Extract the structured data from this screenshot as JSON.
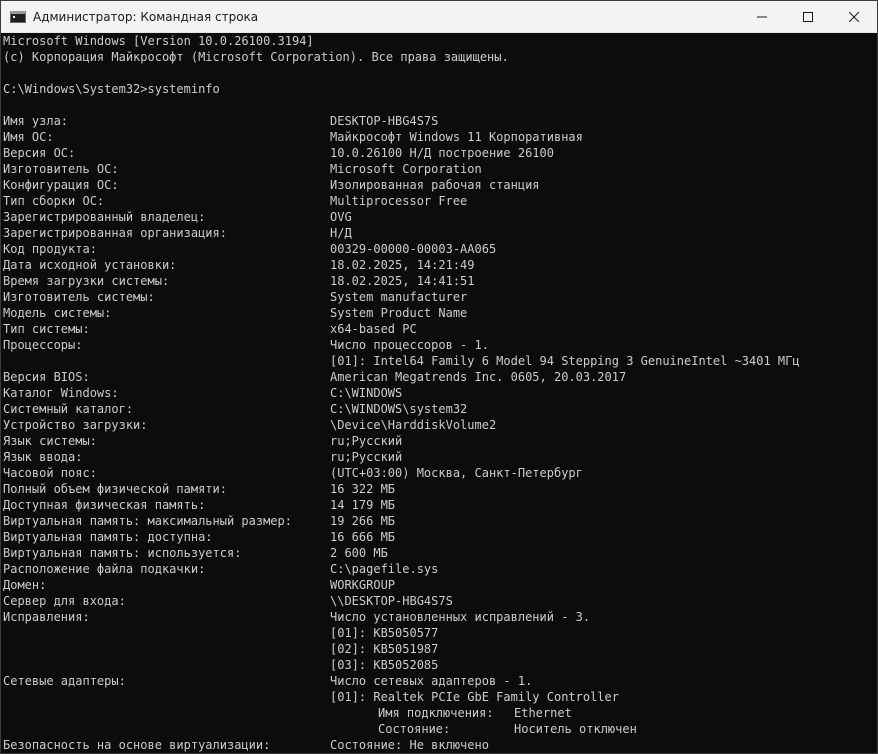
{
  "window": {
    "title": "Администратор: Командная строка",
    "icon": "cmd-icon",
    "controls": {
      "minimize_icon": "minimize-icon",
      "maximize_icon": "maximize-icon",
      "close_icon": "close-icon"
    }
  },
  "console": {
    "header": [
      "Microsoft Windows [Version 10.0.26100.3194]",
      "(c) Корпорация Майкрософт (Microsoft Corporation). Все права защищены."
    ],
    "prompt": "C:\\Windows\\System32>systeminfo",
    "fields": [
      {
        "key": "Имя узла:",
        "value": "DESKTOP-HBG4S7S"
      },
      {
        "key": "Имя ОС:",
        "value": "Майкрософт Windows 11 Корпоративная"
      },
      {
        "key": "Версия ОС:",
        "value": "10.0.26100 Н/Д построение 26100"
      },
      {
        "key": "Изготовитель ОС:",
        "value": "Microsoft Corporation"
      },
      {
        "key": "Конфигурация ОС:",
        "value": "Изолированная рабочая станция"
      },
      {
        "key": "Тип сборки ОС:",
        "value": "Multiprocessor Free"
      },
      {
        "key": "Зарегистрированный владелец:",
        "value": "OVG"
      },
      {
        "key": "Зарегистрированная организация:",
        "value": "Н/Д"
      },
      {
        "key": "Код продукта:",
        "value": "00329-00000-00003-AA065"
      },
      {
        "key": "Дата исходной установки:",
        "value": "18.02.2025, 14:21:49"
      },
      {
        "key": "Время загрузки системы:",
        "value": "18.02.2025, 14:41:51"
      },
      {
        "key": "Изготовитель системы:",
        "value": "System manufacturer"
      },
      {
        "key": "Модель системы:",
        "value": "System Product Name"
      },
      {
        "key": "Тип системы:",
        "value": "x64-based PC"
      },
      {
        "key": "Процессоры:",
        "value": "Число процессоров - 1."
      },
      {
        "key": "",
        "value": "[01]: Intel64 Family 6 Model 94 Stepping 3 GenuineIntel ~3401 МГц"
      },
      {
        "key": "Версия BIOS:",
        "value": "American Megatrends Inc. 0605, 20.03.2017"
      },
      {
        "key": "Каталог Windows:",
        "value": "C:\\WINDOWS"
      },
      {
        "key": "Системный каталог:",
        "value": "C:\\WINDOWS\\system32"
      },
      {
        "key": "Устройство загрузки:",
        "value": "\\Device\\HarddiskVolume2"
      },
      {
        "key": "Язык системы:",
        "value": "ru;Русский"
      },
      {
        "key": "Язык ввода:",
        "value": "ru;Русский"
      },
      {
        "key": "Часовой пояс:",
        "value": "(UTC+03:00) Москва, Санкт-Петербург"
      },
      {
        "key": "Полный объем физической памяти:",
        "value": "16 322 МБ"
      },
      {
        "key": "Доступная физическая память:",
        "value": "14 179 МБ"
      },
      {
        "key": "Виртуальная память: максимальный размер:",
        "value": "19 266 МБ"
      },
      {
        "key": "Виртуальная память: доступна:",
        "value": "16 666 МБ"
      },
      {
        "key": "Виртуальная память: используется:",
        "value": "2 600 МБ"
      },
      {
        "key": "Расположение файла подкачки:",
        "value": "C:\\pagefile.sys"
      },
      {
        "key": "Домен:",
        "value": "WORKGROUP"
      },
      {
        "key": "Сервер для входа:",
        "value": "\\\\DESKTOP-HBG4S7S"
      },
      {
        "key": "Исправления:",
        "value": "Число установленных исправлений - 3."
      },
      {
        "key": "",
        "value": "[01]: KB5050577"
      },
      {
        "key": "",
        "value": "[02]: KB5051987"
      },
      {
        "key": "",
        "value": "[03]: KB5052085"
      },
      {
        "key": "Сетевые адаптеры:",
        "value": "Число сетевых адаптеров - 1."
      },
      {
        "key": "",
        "value": "[01]: Realtek PCIe GbE Family Controller"
      }
    ],
    "adapter_details": [
      {
        "label": "Имя подключения:",
        "value": "Ethernet"
      },
      {
        "label": "Состояние:",
        "value": "Носитель отключен"
      }
    ],
    "last_field": {
      "key": "Безопасность на основе виртуализации:",
      "value": "Состояние: Не включено"
    }
  },
  "colors": {
    "console_bg": "#0c0c0c",
    "console_text": "#cccccc",
    "titlebar_bg": "#f3f3f3"
  }
}
